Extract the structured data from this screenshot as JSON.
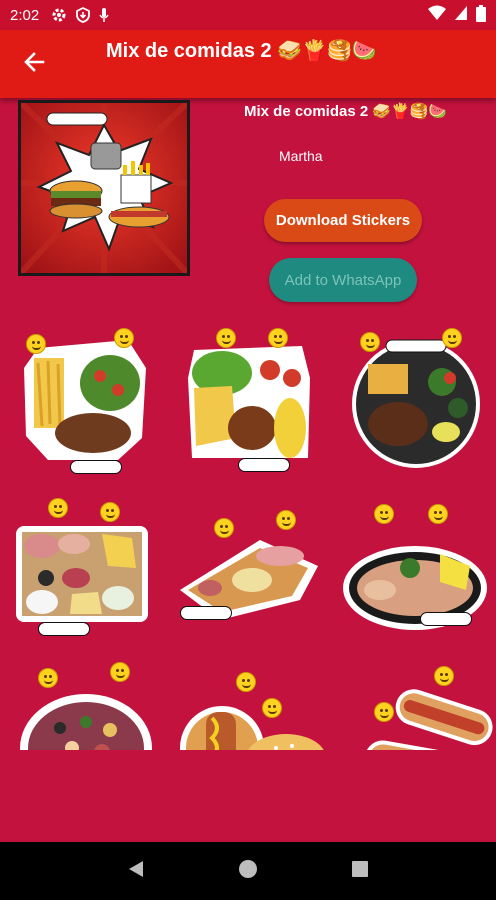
{
  "status_bar": {
    "time": "2:02"
  },
  "app_bar": {
    "title": "Mix de comidas 2 🥪🍟🥞🍉"
  },
  "pack": {
    "name": "Mix de comidas 2 🥪🍟🥞🍉",
    "publisher": "Martha"
  },
  "buttons": {
    "download_label": "Download Stickers",
    "whatsapp_label": "Add to WhatsApp"
  },
  "colors": {
    "background": "#c3123e",
    "app_bar": "#e01b16",
    "download_button": "#d94a16",
    "whatsapp_button": "#1f8a80"
  },
  "stickers": [
    {
      "name": "fries-salad-steak-plate"
    },
    {
      "name": "salad-chicken-corn-plate"
    },
    {
      "name": "steak-fries-grill-plate"
    },
    {
      "name": "charcuterie-board"
    },
    {
      "name": "meat-cheese-tray"
    },
    {
      "name": "cold-cuts-oval-platter"
    },
    {
      "name": "party-platter"
    },
    {
      "name": "hot-dog-burger"
    },
    {
      "name": "hot-dogs-pair"
    }
  ],
  "nav_icons": [
    "back-triangle-icon",
    "home-circle-icon",
    "recents-square-icon"
  ]
}
